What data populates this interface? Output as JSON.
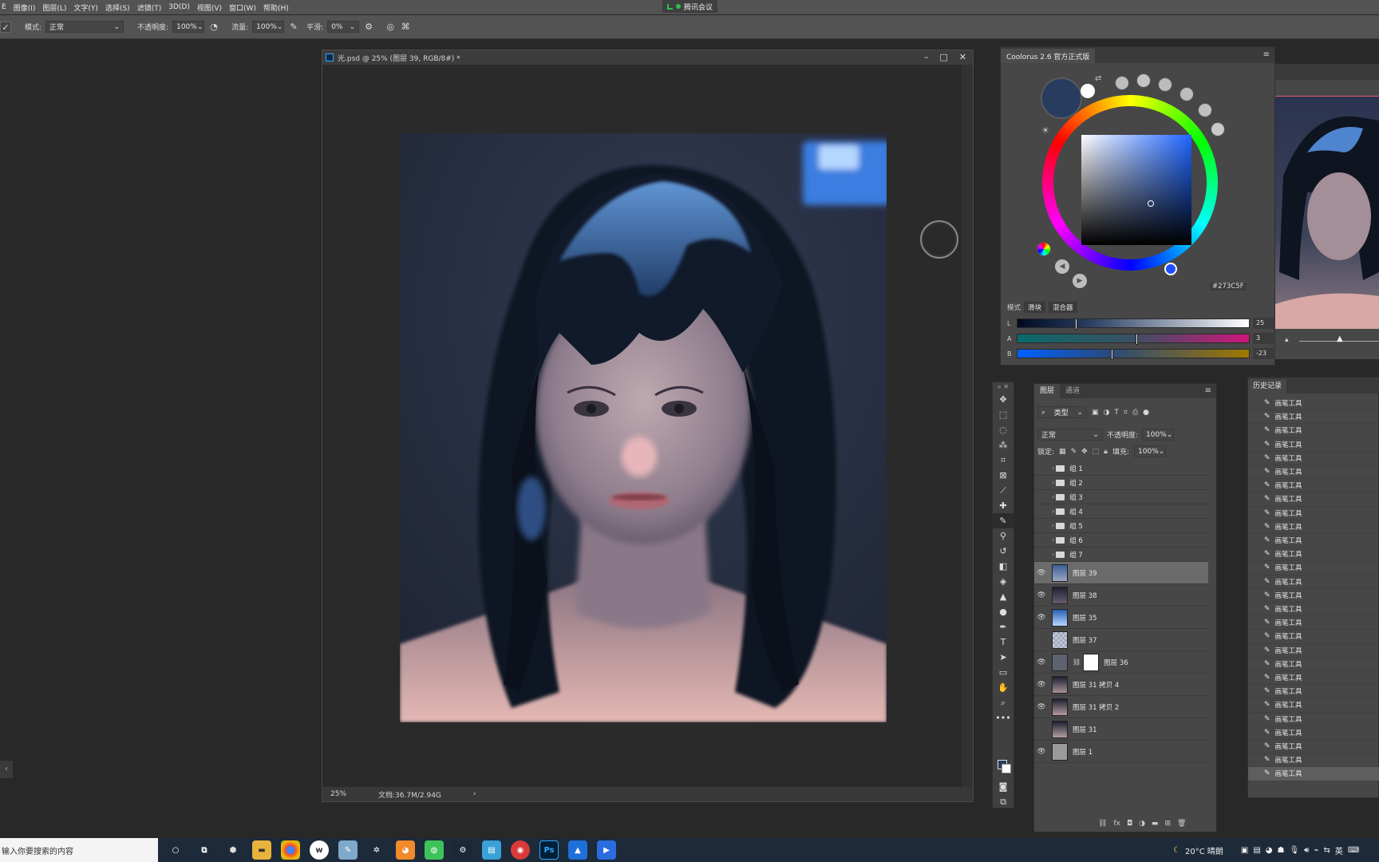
{
  "menubar": {
    "items": [
      "图像(I)",
      "图层(L)",
      "文字(Y)",
      "选择(S)",
      "滤镜(T)",
      "3D(D)",
      "视图(V)",
      "窗口(W)",
      "帮助(H)"
    ],
    "meeting_label": "腾讯会议"
  },
  "options": {
    "mode_label": "模式:",
    "mode_value": "正常",
    "opacity_label": "不透明度:",
    "opacity_value": "100%",
    "flow_label": "流量:",
    "flow_value": "100%",
    "smooth_label": "平滑:",
    "smooth_value": "0%"
  },
  "document": {
    "title": "光.psd @ 25% (图层 39, RGB/8#) *",
    "zoom": "25%",
    "doc_info": "文档:36.7M/2.94G",
    "arrow": "›"
  },
  "coolorus": {
    "tab_title": "Coolorus 2.6 官方正式版",
    "hex": "#273C5F",
    "foreground_color": "#273C5F",
    "mode_label": "模式",
    "mode_buttons": [
      "滑块",
      "混合器"
    ],
    "sliders": [
      {
        "letter": "L",
        "value": "25"
      },
      {
        "letter": "A",
        "value": "3"
      },
      {
        "letter": "B",
        "value": "-23"
      }
    ]
  },
  "layers_panel": {
    "tabs": [
      "图层",
      "通道"
    ],
    "filter_label": "类型",
    "blend_mode": "正常",
    "opacity_label": "不透明度:",
    "opacity_value": "100%",
    "lock_label": "锁定:",
    "fill_label": "填充:",
    "fill_value": "100%",
    "groups": [
      "组 1",
      "组 2",
      "组 3",
      "组 4",
      "组 5",
      "组 6",
      "组 7"
    ],
    "layers": [
      {
        "name": "图层 39",
        "visible": true,
        "selected": true
      },
      {
        "name": "图层 38",
        "visible": true,
        "selected": false
      },
      {
        "name": "图层 35",
        "visible": true,
        "selected": false
      },
      {
        "name": "图层 37",
        "visible": false,
        "selected": false
      },
      {
        "name": "图层 36",
        "visible": true,
        "selected": false
      },
      {
        "name": "图层 31 拷贝 4",
        "visible": true,
        "selected": false
      },
      {
        "name": "图层 31 拷贝 2",
        "visible": true,
        "selected": false
      },
      {
        "name": "图层 31",
        "visible": false,
        "selected": false
      },
      {
        "name": "图层 1",
        "visible": true,
        "selected": false
      }
    ],
    "footer_icons": [
      "link-icon",
      "fx-icon",
      "mask-icon",
      "adjustment-icon",
      "group-icon",
      "new-layer-icon",
      "trash-icon"
    ]
  },
  "history": {
    "title": "历史记录",
    "item_label": "画笔工具",
    "count": 28
  },
  "taskbar": {
    "search_placeholder": "输入你要搜索的内容",
    "weather": "20°C 晴朗",
    "lang": "英"
  }
}
